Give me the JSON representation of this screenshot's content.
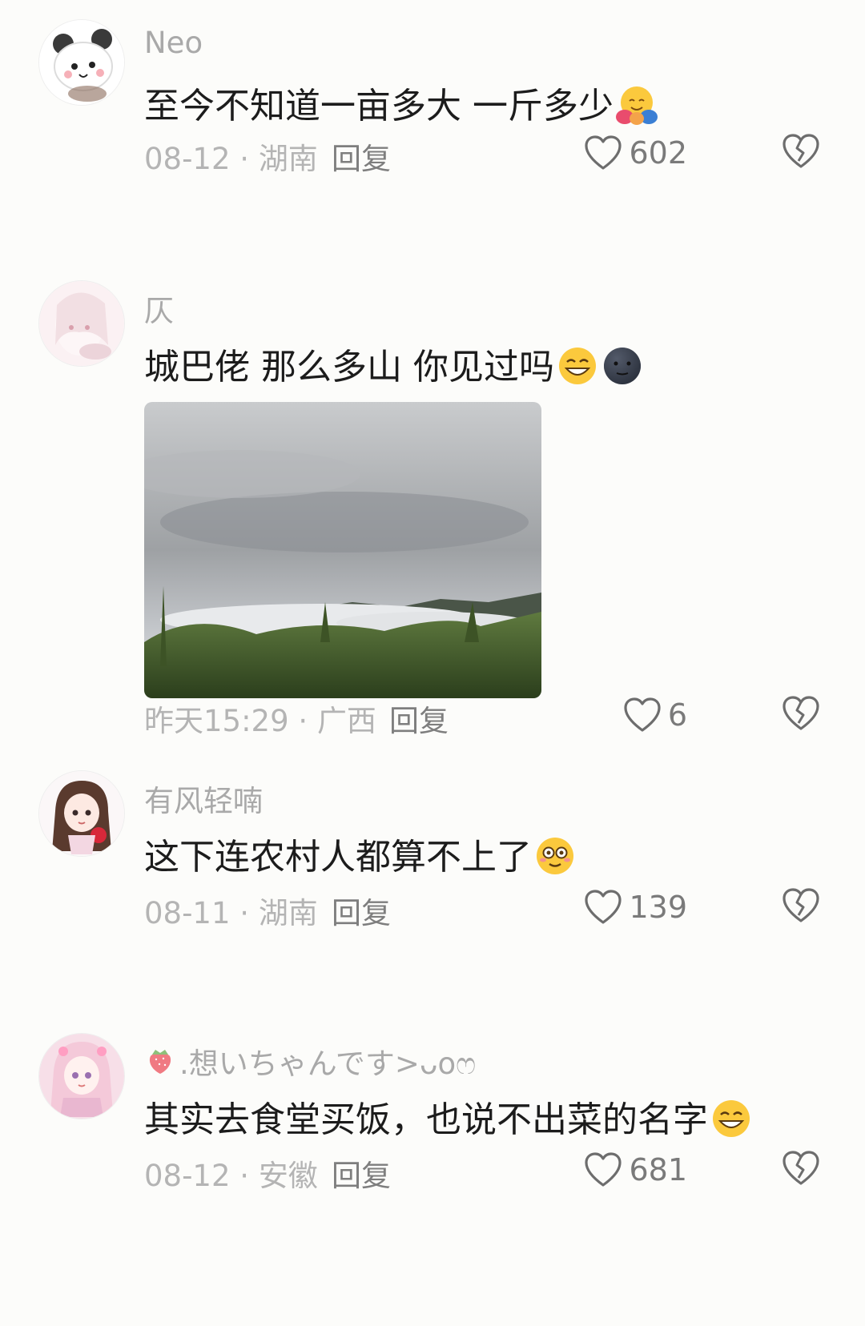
{
  "comments": [
    {
      "username": "Neo",
      "text": "至今不知道一亩多大 一斤多少",
      "emojis": [
        "hugging-face-icon"
      ],
      "date": "08-12",
      "location": "湖南",
      "reply_label": "回复",
      "likes": "602"
    },
    {
      "username": "仄",
      "text": "城巴佬 那么多山 你见过吗",
      "emojis": [
        "grin-squint-icon",
        "dark-moon-face-icon"
      ],
      "date": "昨天15:29",
      "location": "广西",
      "reply_label": "回复",
      "likes": "6"
    },
    {
      "username": "有风轻喃",
      "text": "这下连农村人都算不上了",
      "emojis": [
        "dizzy-face-icon"
      ],
      "date": "08-11",
      "location": "湖南",
      "reply_label": "回复",
      "likes": "139"
    },
    {
      "username": ".想いちゃんです>ᴗoෆ",
      "text": "其实去食堂买饭，也说不出菜的名字",
      "emojis": [
        "grin-squint-icon"
      ],
      "date": "08-12",
      "location": "安徽",
      "reply_label": "回复",
      "likes": "681"
    }
  ],
  "meta_separator": " · ",
  "icons": {
    "like": "heart-outline-icon",
    "dislike": "broken-heart-icon",
    "username_prefix": "strawberry-icon"
  },
  "colors": {
    "background": "#fcfcfa",
    "text": "#1c1c1c",
    "meta": "#b4b4b4",
    "username": "#a9a9a9"
  }
}
